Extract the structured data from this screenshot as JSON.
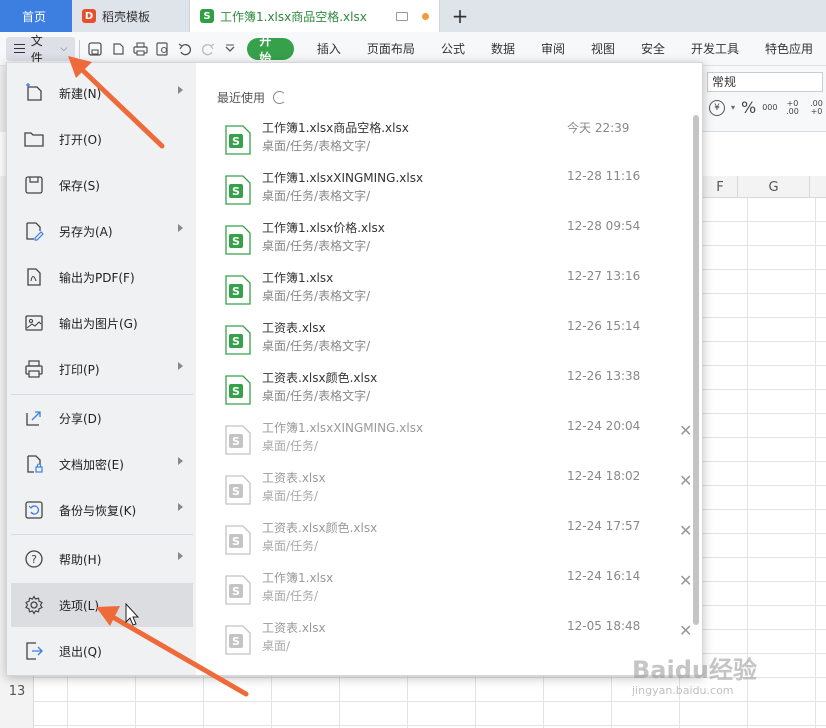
{
  "tabs": {
    "home": "首页",
    "template": "稻壳模板",
    "active_doc": "工作簿1.xlsx商品空格.xlsx",
    "plus": "+"
  },
  "toolbar": {
    "file": "文件",
    "start": "开始",
    "menus": [
      "插入",
      "页面布局",
      "公式",
      "数据",
      "审阅",
      "视图",
      "安全",
      "开发工具",
      "特色应用"
    ]
  },
  "ribbon": {
    "number_format": "常规",
    "thousands": "000",
    "dec_add": "+0 .00",
    "dec_remove": ".00 +0"
  },
  "sheet": {
    "col_f": "F",
    "col_g": "G",
    "row_label": "13"
  },
  "file_menu": {
    "items": [
      {
        "label": "新建(N)",
        "has_submenu": true
      },
      {
        "label": "打开(O)",
        "has_submenu": false
      },
      {
        "label": "保存(S)",
        "has_submenu": false
      },
      {
        "label": "另存为(A)",
        "has_submenu": true
      },
      {
        "label": "输出为PDF(F)",
        "has_submenu": false
      },
      {
        "label": "输出为图片(G)",
        "has_submenu": false
      },
      {
        "label": "打印(P)",
        "has_submenu": true
      },
      {
        "label": "分享(D)",
        "has_submenu": false
      },
      {
        "label": "文档加密(E)",
        "has_submenu": true
      },
      {
        "label": "备份与恢复(K)",
        "has_submenu": true
      },
      {
        "label": "帮助(H)",
        "has_submenu": true
      },
      {
        "label": "选项(L)",
        "has_submenu": false
      },
      {
        "label": "退出(Q)",
        "has_submenu": false
      }
    ],
    "recent_title": "最近使用",
    "recent_files": [
      {
        "name": "工作簿1.xlsx商品空格.xlsx",
        "path": "桌面/任务/表格文字/",
        "time": "今天 22:39",
        "available": true
      },
      {
        "name": "工作簿1.xlsxXINGMING.xlsx",
        "path": "桌面/任务/表格文字/",
        "time": "12-28 11:16",
        "available": true
      },
      {
        "name": "工作簿1.xlsx价格.xlsx",
        "path": "桌面/任务/表格文字/",
        "time": "12-28 09:54",
        "available": true
      },
      {
        "name": "工作簿1.xlsx",
        "path": "桌面/任务/表格文字/",
        "time": "12-27 13:16",
        "available": true
      },
      {
        "name": "工资表.xlsx",
        "path": "桌面/任务/表格文字/",
        "time": "12-26 15:14",
        "available": true
      },
      {
        "name": "工资表.xlsx颜色.xlsx",
        "path": "桌面/任务/表格文字/",
        "time": "12-26 13:38",
        "available": true
      },
      {
        "name": "工作簿1.xlsxXINGMING.xlsx",
        "path": "桌面/任务/",
        "time": "12-24 20:04",
        "available": false
      },
      {
        "name": "工资表.xlsx",
        "path": "桌面/任务/",
        "time": "12-24 18:02",
        "available": false
      },
      {
        "name": "工资表.xlsx颜色.xlsx",
        "path": "桌面/任务/",
        "time": "12-24 17:57",
        "available": false
      },
      {
        "name": "工作簿1.xlsx",
        "path": "桌面/任务/",
        "time": "12-24 16:14",
        "available": false
      },
      {
        "name": "工资表.xlsx",
        "path": "桌面/",
        "time": "12-05 18:48",
        "available": false
      }
    ]
  },
  "watermark": {
    "brand": "Baidu经验",
    "url": "jingyan.baidu.com"
  },
  "colors": {
    "accent_green": "#36a14a",
    "home_tab_blue": "#3d7fe0",
    "arrow_orange": "#ef6a3a"
  }
}
